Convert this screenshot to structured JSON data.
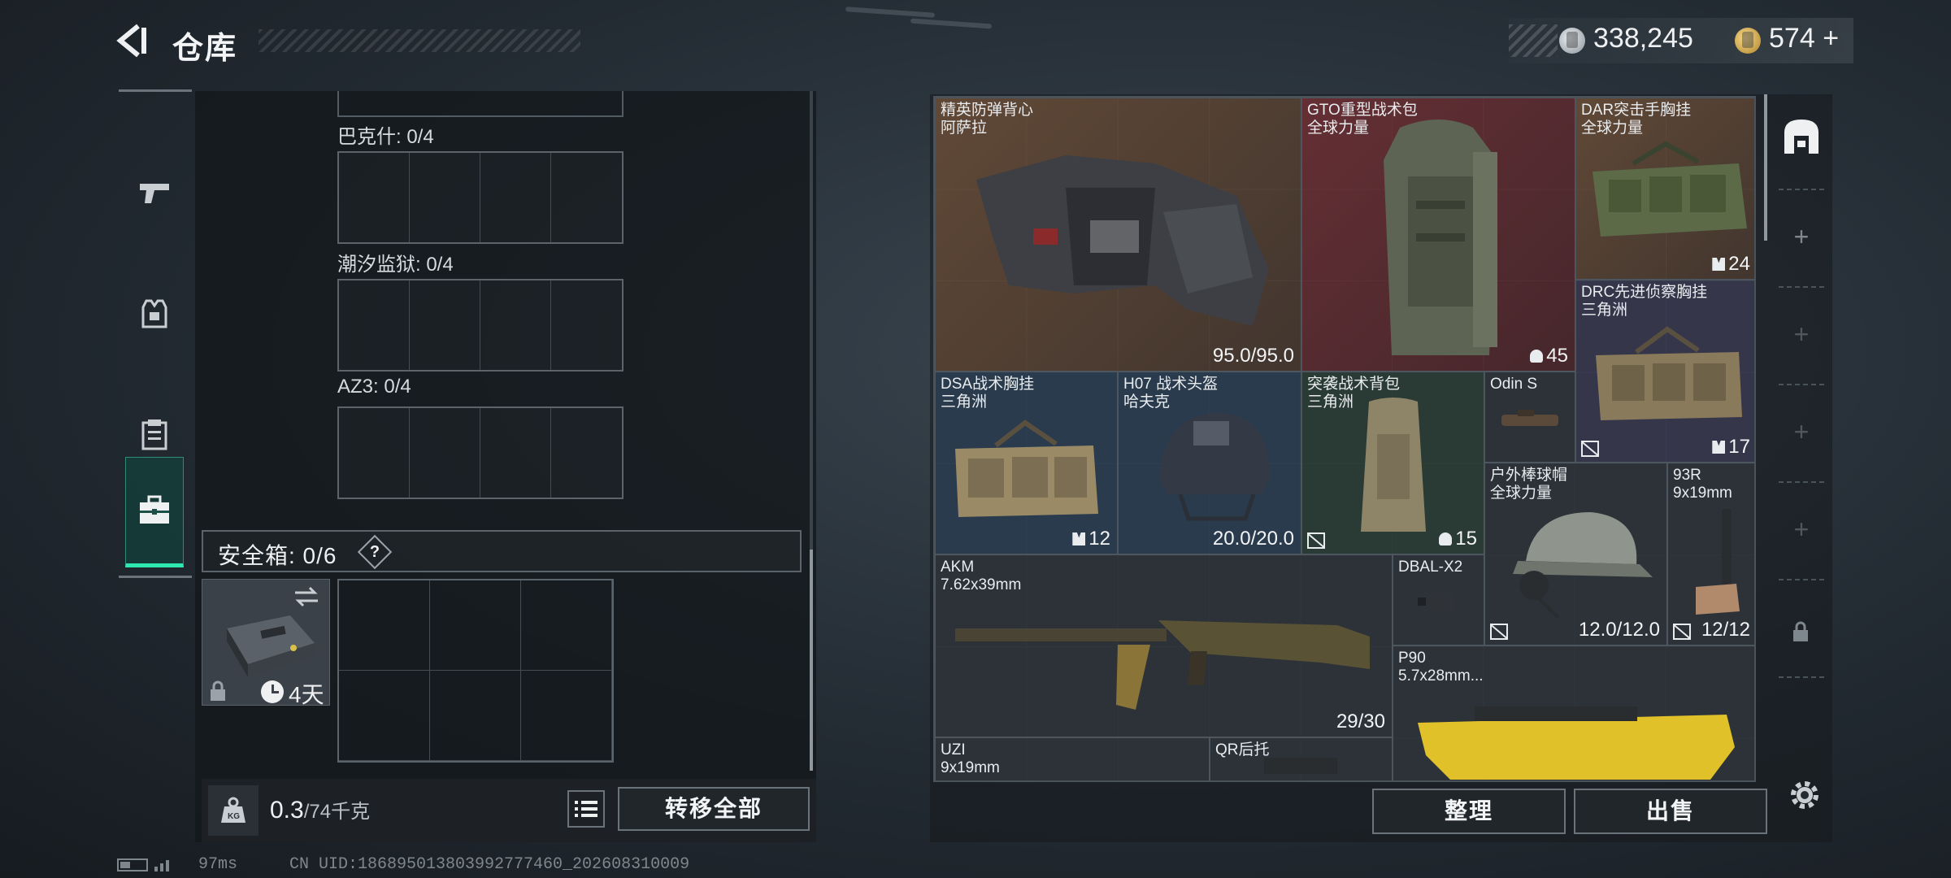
{
  "header": {
    "title": "仓库"
  },
  "currency": {
    "silver": "338,245",
    "gold": "574",
    "gold_plus": "+"
  },
  "left_panel": {
    "sections": [
      {
        "label": "巴克什: 0/4"
      },
      {
        "label": "潮汐监狱: 0/4"
      },
      {
        "label": "AZ3: 0/4"
      }
    ],
    "safe_box": {
      "label": "安全箱: 0/6",
      "help": "?",
      "case_time": "4天"
    },
    "weight": {
      "value": "0.3",
      "max": "/74千克"
    },
    "transfer_label": "转移全部"
  },
  "status": {
    "ping": "97ms",
    "uid": "CN UID:1868950138039927774​60_202608310009"
  },
  "inventory": {
    "items": [
      {
        "name": "精英防弹背心",
        "sub": "阿萨拉",
        "value": "95.0/95.0"
      },
      {
        "name": "GTO重型战术包",
        "sub": "全球力量",
        "value": "45"
      },
      {
        "name": "DAR突击手胸挂",
        "sub": "全球力量",
        "value": "24"
      },
      {
        "name": "DRC先进侦察胸挂",
        "sub": "三角洲",
        "value": "17"
      },
      {
        "name": "DSA战术胸挂",
        "sub": "三角洲",
        "value": "12"
      },
      {
        "name": "H07 战术头盔",
        "sub": "哈夫克",
        "value": "20.0/20.0"
      },
      {
        "name": "突袭战术背包",
        "sub": "三角洲",
        "value": "15"
      },
      {
        "name": "Odin S",
        "sub": "",
        "value": ""
      },
      {
        "name": "户外棒球帽",
        "sub": "全球力量",
        "value": "12.0/12.0"
      },
      {
        "name": "93R",
        "sub": "9x19mm",
        "value": "12/12"
      },
      {
        "name": "AKM",
        "sub": "7.62x39mm",
        "value": "29/30"
      },
      {
        "name": "DBAL-X2",
        "sub": "",
        "value": ""
      },
      {
        "name": "P90",
        "sub": "5.7x28mm...",
        "value": ""
      },
      {
        "name": "UZI",
        "sub": "9x19mm",
        "value": ""
      },
      {
        "name": "QR后托",
        "sub": "",
        "value": ""
      }
    ]
  },
  "actions": {
    "sort": "整理",
    "sell": "出售"
  },
  "colors": {
    "accent": "#2ee8b0",
    "panel": "#21262b",
    "text": "#eef0f2"
  }
}
